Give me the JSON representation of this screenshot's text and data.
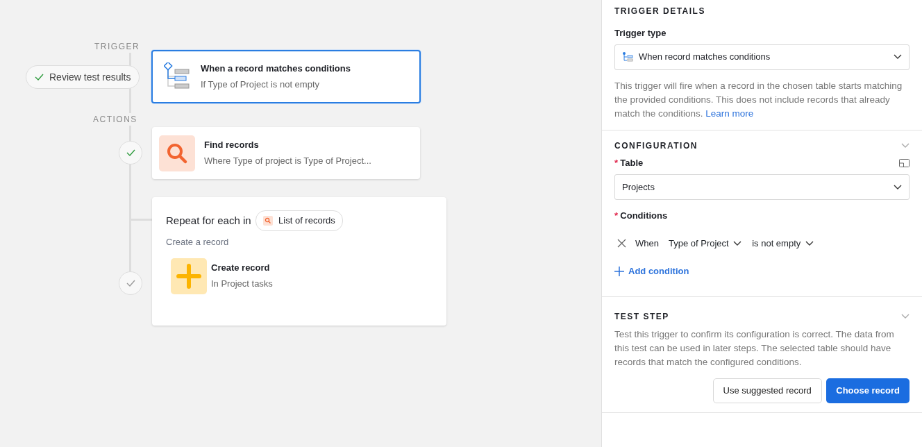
{
  "canvas": {
    "trigger_label": "TRIGGER",
    "review_button": {
      "label": "Review test results",
      "checked": true
    },
    "trigger_card": {
      "title": "When a record matches conditions",
      "subtitle": "If Type of Project is not empty",
      "selected": true
    },
    "actions_label": "ACTIONS",
    "steps": [
      {
        "kind": "find",
        "title": "Find records",
        "subtitle": "Where Type of project is Type of Project...",
        "done": true,
        "selected": false
      },
      {
        "kind": "repeat",
        "title": "Repeat for each in",
        "chip": "List of records",
        "group_label": "Create a record",
        "done": false,
        "selected": false,
        "children": [
          {
            "kind": "create",
            "title": "Create record",
            "subtitle": "In Project tasks"
          }
        ]
      }
    ]
  },
  "panel": {
    "trigger_details": {
      "heading": "TRIGGER DETAILS",
      "type_label": "Trigger type",
      "type_value": "When record matches conditions",
      "description": "This trigger will fire when a record in the chosen table starts matching the provided conditions. This does not include records that already match the conditions.",
      "link": "Learn more"
    },
    "configuration": {
      "heading": "CONFIGURATION",
      "expanded": true,
      "required_mark": "*",
      "table_label": "Table",
      "table_required": true,
      "table_value": "Projects",
      "conditions_label": "Conditions",
      "conditions_required": true,
      "conditions": [
        {
          "prefix": "When",
          "field": "Type of Project",
          "operator": "is not empty"
        }
      ],
      "add_condition": "Add condition"
    },
    "test_step": {
      "heading": "TEST STEP",
      "expanded": true,
      "description": "Test this trigger to confirm its configuration is correct. The data from this test can be used in later steps. The selected table should have records that match the configured conditions.",
      "buttons": [
        {
          "label": "Use suggested record",
          "kind": "secondary"
        },
        {
          "label": "Choose record",
          "kind": "primary"
        }
      ]
    }
  }
}
